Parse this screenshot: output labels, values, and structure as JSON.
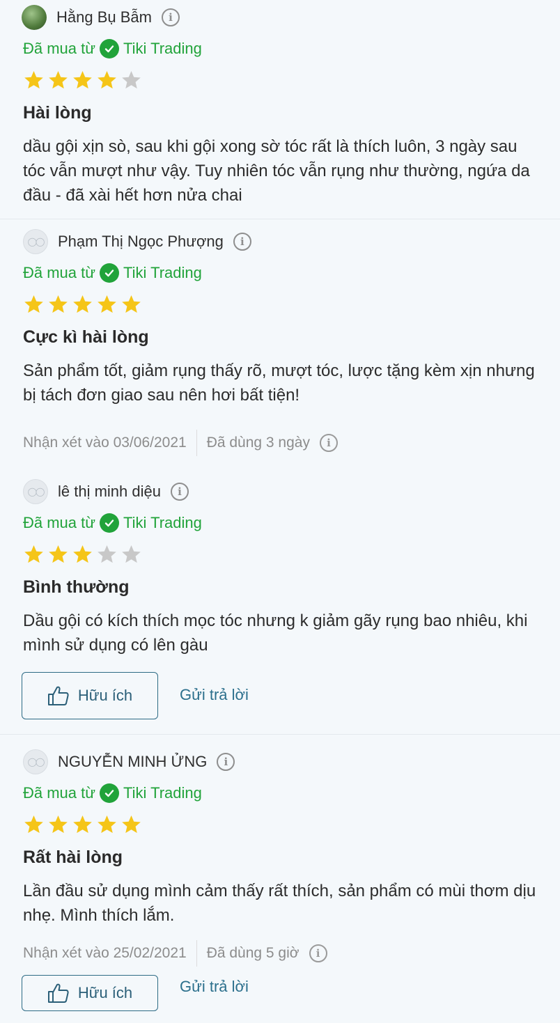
{
  "colors": {
    "green": "#21a33a",
    "star_filled": "#f5c518",
    "star_empty": "#c8c8c8",
    "link": "#2b6f8c"
  },
  "reviews": [
    {
      "user": "Hằng Bụ Bẫm",
      "avatar": "photo",
      "bought_prefix": "Đã mua từ",
      "seller": "Tiki Trading",
      "rating": 4,
      "title": "Hài lòng",
      "content": "dầu gội xịn sò, sau khi gội xong sờ tóc rất là thích luôn, 3 ngày sau tóc vẫn mượt như vậy. Tuy nhiên tóc vẫn rụng như thường, ngứa da đầu - đã xài hết hơn nửa chai"
    },
    {
      "user": "Phạm Thị Ngọc Phượng",
      "avatar": "default",
      "bought_prefix": "Đã mua từ",
      "seller": "Tiki Trading",
      "rating": 5,
      "title": "Cực kì hài lòng",
      "content": "Sản phẩm tốt, giảm rụng thấy rõ, mượt tóc, lược tặng kèm xịn nhưng bị tách đơn giao sau nên hơi bất tiện!",
      "reviewed_on": "Nhận xét vào 03/06/2021",
      "used_for": "Đã dùng 3 ngày"
    },
    {
      "user": "lê thị minh diệu",
      "avatar": "default",
      "bought_prefix": "Đã mua từ",
      "seller": "Tiki Trading",
      "rating": 3,
      "title": "Bình thường",
      "content": "Dầu gội có kích thích mọc tóc nhưng k giảm gãy rụng bao nhiêu, khi mình sử dụng có lên gàu",
      "helpful_label": "Hữu ích",
      "reply_label": "Gửi trả lời"
    },
    {
      "user": "NGUYỄN MINH ỬNG",
      "avatar": "default",
      "bought_prefix": "Đã mua từ",
      "seller": "Tiki Trading",
      "rating": 5,
      "title": "Rất hài lòng",
      "content": "Lần đầu sử dụng mình cảm thấy rất thích, sản phẩm có mùi thơm dịu nhẹ. Mình thích lắm.",
      "reviewed_on": "Nhận xét vào 25/02/2021",
      "used_for": "Đã dùng 5 giờ",
      "helpful_label": "Hữu ích",
      "reply_label": "Gửi trả lời"
    }
  ]
}
